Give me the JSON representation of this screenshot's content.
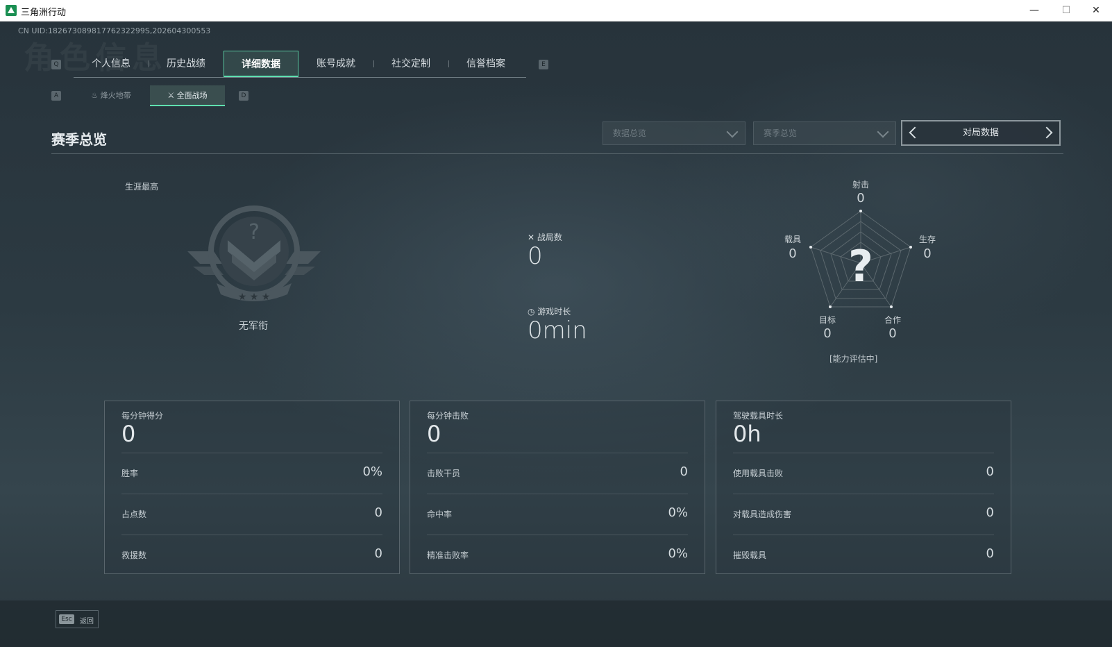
{
  "window": {
    "title": "三角洲行动",
    "minimize": "—",
    "maximize": "☐",
    "close": "✕"
  },
  "uid_text": "CN UID:18267308981776232299S,202604300553",
  "watermark": "角色信息",
  "keys": {
    "q": "Q",
    "e": "E",
    "a": "A",
    "d": "D"
  },
  "tabs": [
    {
      "label": "个人信息"
    },
    {
      "label": "历史战绩"
    },
    {
      "label": "详细数据",
      "active": true
    },
    {
      "label": "账号成就"
    },
    {
      "label": "社交定制"
    },
    {
      "label": "信誉档案"
    }
  ],
  "subtabs": [
    {
      "label": "烽火地带"
    },
    {
      "label": "全面战场",
      "active": true
    }
  ],
  "section": {
    "title": "赛季总览",
    "dropdown1": "数据总览",
    "dropdown2": "赛季总览",
    "pager_label": "对局数据"
  },
  "career": {
    "label": "生涯最高",
    "rank_name": "无军衔"
  },
  "mid_stats": {
    "matches_label": "战局数",
    "matches_value": "0",
    "playtime_label": "游戏时长",
    "playtime_value": "0min"
  },
  "radar": {
    "labels": {
      "top": "射击",
      "right": "生存",
      "bottom_right": "合作",
      "bottom_left": "目标",
      "left": "载具"
    },
    "values": {
      "top": "0",
      "right": "0",
      "bottom_right": "0",
      "bottom_left": "0",
      "left": "0"
    },
    "center_mark": "?",
    "note": "[能力评估中]"
  },
  "panels": [
    {
      "title": "每分钟得分",
      "value": "0",
      "rows": [
        {
          "label": "胜率",
          "value": "0%"
        },
        {
          "label": "占点数",
          "value": "0"
        },
        {
          "label": "救援数",
          "value": "0"
        }
      ]
    },
    {
      "title": "每分钟击败",
      "value": "0",
      "rows": [
        {
          "label": "击败干员",
          "value": "0"
        },
        {
          "label": "命中率",
          "value": "0%"
        },
        {
          "label": "精准击败率",
          "value": "0%"
        }
      ]
    },
    {
      "title": "驾驶载具时长",
      "value": "0h",
      "rows": [
        {
          "label": "使用载具击败",
          "value": "0"
        },
        {
          "label": "对载具造成伤害",
          "value": "0"
        },
        {
          "label": "摧毁载具",
          "value": "0"
        }
      ]
    }
  ],
  "bottom": {
    "esc_key": "Esc",
    "esc_label": "返回"
  },
  "colors": {
    "accent": "#5fe0b0",
    "bg": "#27333b"
  }
}
